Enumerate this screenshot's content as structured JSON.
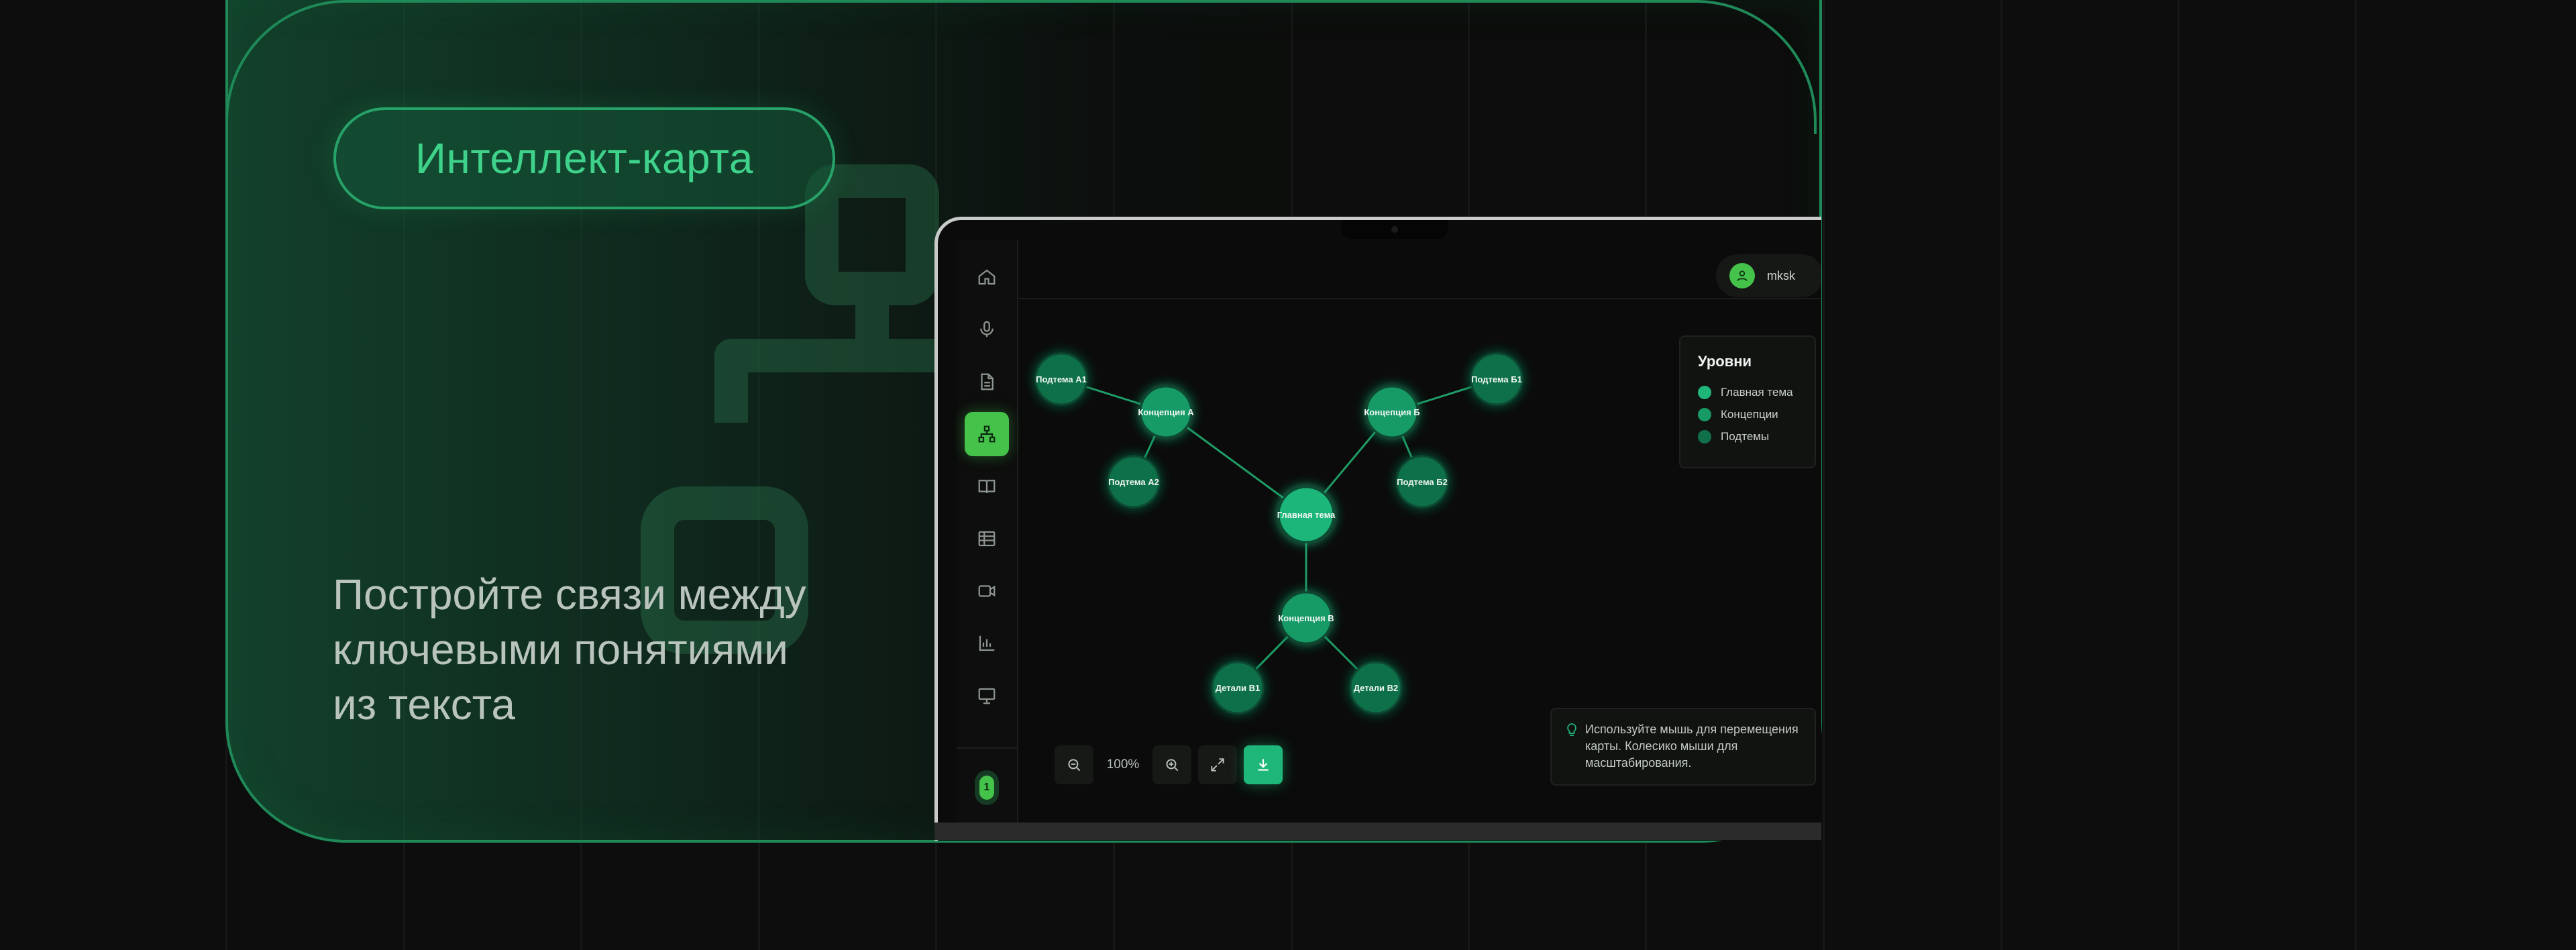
{
  "hero": {
    "badge_label": "Интеллект-карта",
    "tagline_lines": [
      "Постройте связи между",
      "ключевыми понятиями",
      "из текста"
    ]
  },
  "app": {
    "user_name": "mksk",
    "sidebar_items": [
      {
        "icon": "home-icon",
        "active": false
      },
      {
        "icon": "microphone-icon",
        "active": false
      },
      {
        "icon": "document-icon",
        "active": false
      },
      {
        "icon": "mind-map-icon",
        "active": true
      },
      {
        "icon": "book-icon",
        "active": false
      },
      {
        "icon": "table-icon",
        "active": false
      },
      {
        "icon": "video-icon",
        "active": false
      },
      {
        "icon": "bar-chart-icon",
        "active": false
      },
      {
        "icon": "presentation-icon",
        "active": false
      }
    ],
    "sidebar_footer_badge": "1",
    "mind_map": {
      "nodes": [
        {
          "id": "root",
          "label": "Главная тема",
          "level": "main"
        },
        {
          "id": "a",
          "label": "Концепция A",
          "level": "concept"
        },
        {
          "id": "b",
          "label": "Концепция Б",
          "level": "concept"
        },
        {
          "id": "c",
          "label": "Концепция В",
          "level": "concept"
        },
        {
          "id": "a1",
          "label": "Подтема A1",
          "level": "subtopic"
        },
        {
          "id": "a2",
          "label": "Подтема A2",
          "level": "subtopic"
        },
        {
          "id": "b1",
          "label": "Подтема Б1",
          "level": "subtopic"
        },
        {
          "id": "b2",
          "label": "Подтема Б2",
          "level": "subtopic"
        },
        {
          "id": "c1",
          "label": "Детали В1",
          "level": "subtopic"
        },
        {
          "id": "c2",
          "label": "Детали В2",
          "level": "subtopic"
        }
      ],
      "edges": [
        [
          "root",
          "a"
        ],
        [
          "root",
          "b"
        ],
        [
          "root",
          "c"
        ],
        [
          "a",
          "a1"
        ],
        [
          "a",
          "a2"
        ],
        [
          "b",
          "b1"
        ],
        [
          "b",
          "b2"
        ],
        [
          "c",
          "c1"
        ],
        [
          "c",
          "c2"
        ]
      ]
    },
    "legend": {
      "title": "Уровни",
      "items": [
        {
          "label": "Главная тема",
          "color": "#1fb67a"
        },
        {
          "label": "Концепции",
          "color": "#179a66"
        },
        {
          "label": "Подтемы",
          "color": "#10704a"
        }
      ]
    },
    "toolbar": {
      "zoom_label": "100%"
    },
    "hint_text": "Используйте мышь для перемещения карты. Колесико мыши для масштабирования."
  },
  "colors": {
    "accent": "#1fb67a",
    "sidebar_active": "#44c24a",
    "card_border": "#1f8a58"
  }
}
